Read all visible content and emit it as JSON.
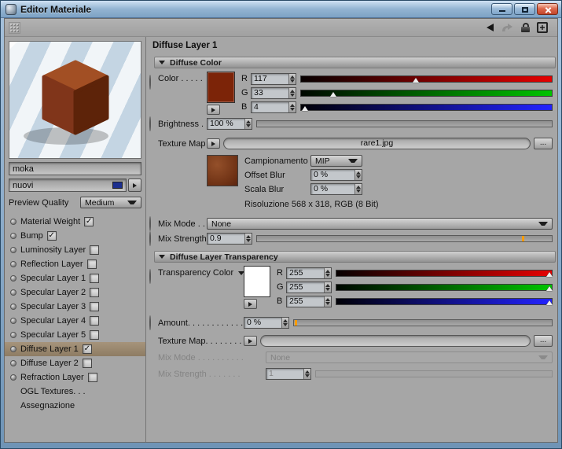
{
  "window": {
    "title": "Editor Materiale"
  },
  "left": {
    "material_name": "moka",
    "layer_name": "nuovi",
    "layer_color": "#1c2f8f",
    "preview_quality_label": "Preview Quality",
    "preview_quality_value": "Medium",
    "channels": [
      {
        "label": "Material Weight",
        "check": "✓"
      },
      {
        "label": "Bump",
        "check": "✓"
      },
      {
        "label": "Luminosity Layer",
        "check": ""
      },
      {
        "label": "Reflection Layer",
        "check": ""
      },
      {
        "label": "Specular Layer 1",
        "check": ""
      },
      {
        "label": "Specular Layer 2",
        "check": ""
      },
      {
        "label": "Specular Layer 3",
        "check": ""
      },
      {
        "label": "Specular Layer 4",
        "check": ""
      },
      {
        "label": "Specular Layer 5",
        "check": ""
      },
      {
        "label": "Diffuse Layer 1",
        "check": "✓"
      },
      {
        "label": "Diffuse Layer 2",
        "check": ""
      },
      {
        "label": "Refraction Layer",
        "check": ""
      }
    ],
    "extra": [
      {
        "label": "OGL Textures. . ."
      },
      {
        "label": "Assegnazione"
      }
    ]
  },
  "main": {
    "header": "Diffuse Layer 1",
    "browse": "...",
    "color": {
      "section": "Diffuse Color",
      "label": "Color . . . . .",
      "swatch": "#7c2408",
      "r": {
        "label": "R",
        "value": "117",
        "pos": "45.9%"
      },
      "g": {
        "label": "G",
        "value": "33",
        "pos": "12.9%"
      },
      "b": {
        "label": "B",
        "value": "4",
        "pos": "1.6%"
      },
      "brightness_label": "Brightness .",
      "brightness_value": "100 %",
      "texture_label": "Texture Map",
      "texture_value": "rare1.jpg",
      "sampling_label": "Campionamento",
      "sampling_value": "MIP",
      "offset_label": "Offset Blur",
      "offset_value": "0 %",
      "scale_label": "Scala Blur",
      "scale_value": "0 %",
      "resolution": "Risoluzione 568 x 318, RGB (8 Bit)",
      "mix_mode_label": "Mix Mode . .",
      "mix_mode_value": "None",
      "mix_strength_label": "Mix Strength",
      "mix_strength_value": "0.9",
      "mix_strength_pos": "90%"
    },
    "transparency": {
      "section": "Diffuse Layer Transparency",
      "label": "Transparency Color",
      "swatch": "#ffffff",
      "r": {
        "label": "R",
        "value": "255",
        "pos": "98.8%"
      },
      "g": {
        "label": "G",
        "value": "255",
        "pos": "98.8%"
      },
      "b": {
        "label": "B",
        "value": "255",
        "pos": "98.8%"
      },
      "amount_label": "Amount. . . . . . . . . . . .",
      "amount_value": "0 %",
      "amount_pos": "0.6%",
      "texture_label": "Texture Map. . . . . . . .",
      "mix_mode_label": "Mix Mode . . . . . . . . . .",
      "mix_mode_value": "None",
      "mix_strength_label": "Mix Strength . . . . . . .",
      "mix_strength_value": "1"
    }
  }
}
